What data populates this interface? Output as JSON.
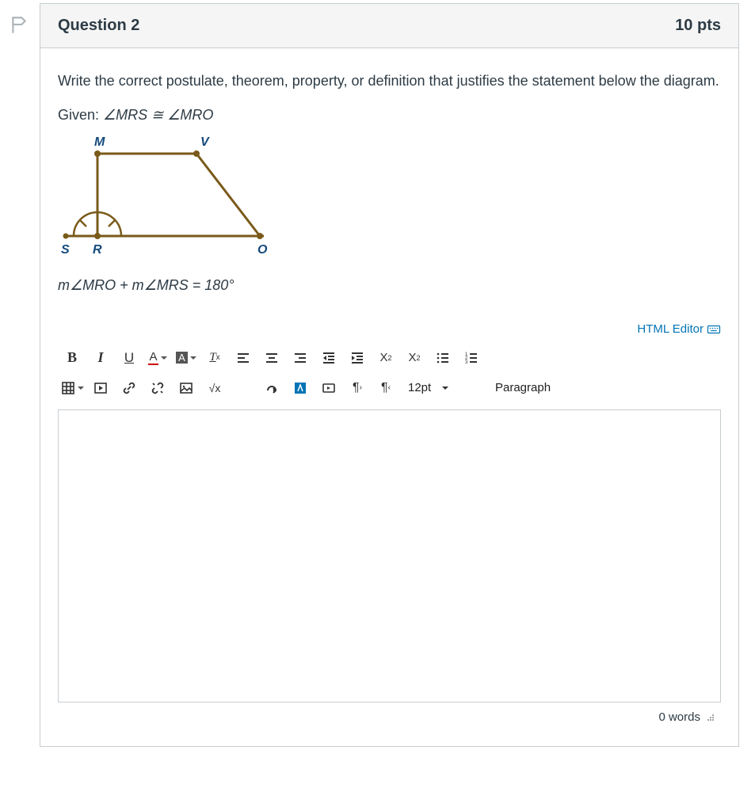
{
  "header": {
    "title": "Question 2",
    "points": "10 pts"
  },
  "prompt": "Write the correct postulate, theorem, property, or definition that justifies the statement below the diagram.",
  "given_prefix": "Given: ",
  "given_expr": "∠MRS ≅ ∠MRO",
  "diagram_labels": {
    "M": "M",
    "V": "V",
    "S": "S",
    "R": "R",
    "O": "O"
  },
  "statement": "m∠MRO + m∠MRS = 180°",
  "editor": {
    "html_editor_label": "HTML Editor",
    "fontsize": "12pt",
    "paragraph": "Paragraph",
    "wordcount": "0 words"
  },
  "toolbar": {
    "bold": "B",
    "italic": "I",
    "underline": "U",
    "textcolor": "A",
    "highlight": "A",
    "math": "√x"
  }
}
